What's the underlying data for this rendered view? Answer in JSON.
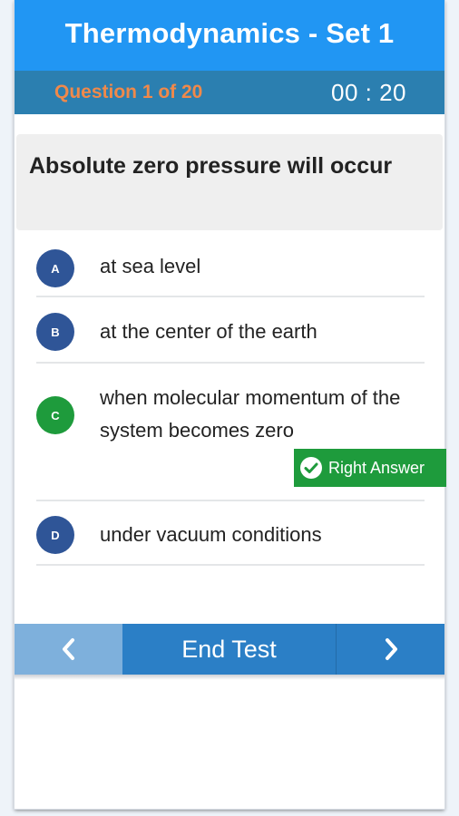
{
  "header": {
    "title": "Thermodynamics - Set 1"
  },
  "status": {
    "question_counter": "Question 1 of 20",
    "timer": "00 : 20"
  },
  "question": {
    "text": "Absolute zero pressure will occur"
  },
  "options": [
    {
      "letter": "A",
      "text": "at sea level",
      "badge_color": "#2f5597"
    },
    {
      "letter": "B",
      "text": "at the center of the earth",
      "badge_color": "#2f5597"
    },
    {
      "letter": "C",
      "text": "when molecular momentum of the system becomes zero",
      "badge_color": "#1e9b3c",
      "feedback": "Right Answer"
    },
    {
      "letter": "D",
      "text": "under vacuum conditions",
      "badge_color": "#2f5597"
    }
  ],
  "nav": {
    "prev_icon": "chevron-left-icon",
    "end_label": "End Test",
    "next_icon": "chevron-right-icon"
  },
  "colors": {
    "header_bg": "#2196f3",
    "subheader_bg": "#2b7fb0",
    "counter_text": "#f0894a",
    "correct_green": "#1e9b3c",
    "nav_blue": "#2b7fc6",
    "nav_disabled": "#7eb0dc"
  }
}
